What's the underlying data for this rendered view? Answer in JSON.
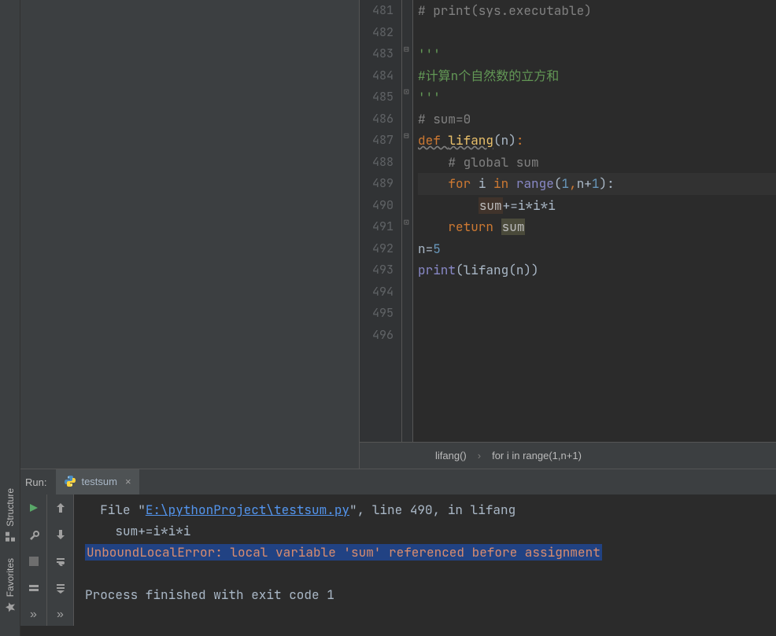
{
  "sidebar": {
    "structure_label": "Structure",
    "favorites_label": "Favorites"
  },
  "editor": {
    "lines": [
      {
        "n": 481,
        "tokens": [
          {
            "cls": "com",
            "t": "# print(sys.executable)"
          }
        ]
      },
      {
        "n": 482,
        "tokens": []
      },
      {
        "n": 483,
        "tokens": [
          {
            "cls": "doc",
            "t": "'''"
          }
        ]
      },
      {
        "n": 484,
        "tokens": [
          {
            "cls": "doc",
            "t": "#计算n个自然数的立方和"
          }
        ]
      },
      {
        "n": 485,
        "tokens": [
          {
            "cls": "doc",
            "t": "'''"
          }
        ]
      },
      {
        "n": 486,
        "tokens": [
          {
            "cls": "com",
            "t": "# sum=0"
          }
        ]
      },
      {
        "n": 487,
        "tokens": [
          {
            "cls": "kw underline-wavy",
            "t": "def "
          },
          {
            "cls": "fn underline-wavy",
            "t": "lifang"
          },
          {
            "cls": "id",
            "t": "(n)"
          },
          {
            "cls": "kw",
            "t": ":"
          }
        ]
      },
      {
        "n": 488,
        "tokens": [
          {
            "cls": "id",
            "t": "    "
          },
          {
            "cls": "com",
            "t": "# global sum"
          }
        ]
      },
      {
        "n": 489,
        "current": true,
        "tokens": [
          {
            "cls": "id",
            "t": "    "
          },
          {
            "cls": "kw",
            "t": "for"
          },
          {
            "cls": "id",
            "t": " i "
          },
          {
            "cls": "kw",
            "t": "in"
          },
          {
            "cls": "id",
            "t": " "
          },
          {
            "cls": "bi",
            "t": "range"
          },
          {
            "cls": "id",
            "t": "("
          },
          {
            "cls": "num",
            "t": "1"
          },
          {
            "cls": "kw",
            "t": ","
          },
          {
            "cls": "id",
            "t": "n+"
          },
          {
            "cls": "num",
            "t": "1"
          },
          {
            "cls": "id",
            "t": "):"
          }
        ]
      },
      {
        "n": 490,
        "tokens": [
          {
            "cls": "id",
            "t": "        "
          },
          {
            "cls": "hl-sum",
            "t": "sum"
          },
          {
            "cls": "id",
            "t": "+=i*i*i"
          }
        ]
      },
      {
        "n": 491,
        "tokens": [
          {
            "cls": "id",
            "t": "    "
          },
          {
            "cls": "kw",
            "t": "return"
          },
          {
            "cls": "id",
            "t": " "
          },
          {
            "cls": "hl-sum2",
            "t": "sum"
          }
        ]
      },
      {
        "n": 492,
        "tokens": [
          {
            "cls": "id",
            "t": "n="
          },
          {
            "cls": "num",
            "t": "5"
          }
        ]
      },
      {
        "n": 493,
        "tokens": [
          {
            "cls": "bi",
            "t": "print"
          },
          {
            "cls": "id",
            "t": "(lifang(n))"
          }
        ]
      },
      {
        "n": 494,
        "tokens": []
      },
      {
        "n": 495,
        "tokens": []
      },
      {
        "n": 496,
        "tokens": []
      }
    ]
  },
  "breadcrumb": {
    "items": [
      "lifang()",
      "for i in range(1,n+1)"
    ]
  },
  "run": {
    "label": "Run:",
    "tab_name": "testsum",
    "console_line1_prefix": "  File \"",
    "console_link": "E:\\pythonProject\\testsum.py",
    "console_line1_suffix": "\", line 490, in lifang",
    "console_line2": "    sum+=i*i*i",
    "console_err": "UnboundLocalError: local variable 'sum' referenced before assignment",
    "console_exit": "Process finished with exit code 1"
  }
}
